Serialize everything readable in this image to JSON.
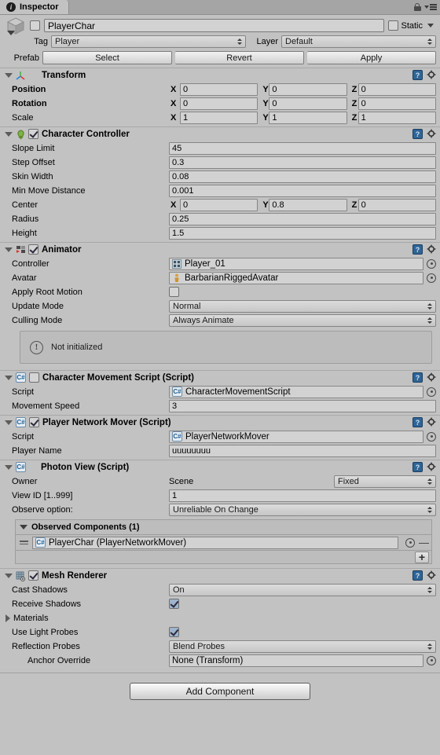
{
  "window": {
    "tab_label": "Inspector",
    "tab_icon": "info-icon",
    "lock_icon": "lock-icon",
    "menu_icon": "hamburger-menu-icon"
  },
  "gameobject": {
    "enabled": false,
    "name": "PlayerChar",
    "static_label": "Static",
    "static_checked": false,
    "tag_label": "Tag",
    "tag_value": "Player",
    "layer_label": "Layer",
    "layer_value": "Default",
    "prefab_label": "Prefab",
    "prefab_buttons": [
      "Select",
      "Revert",
      "Apply"
    ]
  },
  "components": [
    {
      "id": "transform",
      "title": "Transform",
      "icon": "transform-axis-icon",
      "has_checkbox": false,
      "rows": [
        {
          "type": "vector3",
          "label": "Position",
          "bold": true,
          "x": "0",
          "y": "0",
          "z": "0"
        },
        {
          "type": "vector3",
          "label": "Rotation",
          "bold": true,
          "x": "0",
          "y": "0",
          "z": "0"
        },
        {
          "type": "vector3",
          "label": "Scale",
          "bold": false,
          "x": "1",
          "y": "1",
          "z": "1"
        }
      ]
    },
    {
      "id": "character-controller",
      "title": "Character Controller",
      "icon": "character-controller-icon",
      "has_checkbox": true,
      "checked": true,
      "rows": [
        {
          "type": "text",
          "label": "Slope Limit",
          "value": "45"
        },
        {
          "type": "text",
          "label": "Step Offset",
          "value": "0.3"
        },
        {
          "type": "text",
          "label": "Skin Width",
          "value": "0.08"
        },
        {
          "type": "text",
          "label": "Min Move Distance",
          "value": "0.001"
        },
        {
          "type": "vector3",
          "label": "Center",
          "bold": false,
          "x": "0",
          "y": "0.8",
          "z": "0"
        },
        {
          "type": "text",
          "label": "Radius",
          "value": "0.25"
        },
        {
          "type": "text",
          "label": "Height",
          "value": "1.5"
        }
      ]
    },
    {
      "id": "animator",
      "title": "Animator",
      "icon": "animator-icon",
      "has_checkbox": true,
      "checked": true,
      "rows": [
        {
          "type": "object",
          "label": "Controller",
          "value": "Player_01",
          "icon": "animator-controller-icon"
        },
        {
          "type": "object",
          "label": "Avatar",
          "value": "BarbarianRiggedAvatar",
          "icon": "avatar-icon"
        },
        {
          "type": "checkbox",
          "label": "Apply Root Motion",
          "checked": false
        },
        {
          "type": "dropdown",
          "label": "Update Mode",
          "value": "Normal"
        },
        {
          "type": "dropdown",
          "label": "Culling Mode",
          "value": "Always Animate"
        },
        {
          "type": "helpbox",
          "message": "Not initialized",
          "icon": "warning-icon"
        }
      ]
    },
    {
      "id": "character-movement-script",
      "title": "Character Movement Script (Script)",
      "icon": "cs-script-icon",
      "has_checkbox": true,
      "checked": false,
      "rows": [
        {
          "type": "object",
          "label": "Script",
          "value": "CharacterMovementScript",
          "icon": "cs-script-icon"
        },
        {
          "type": "text",
          "label": "Movement Speed",
          "value": "3"
        }
      ]
    },
    {
      "id": "player-network-mover",
      "title": "Player Network Mover (Script)",
      "icon": "cs-script-icon",
      "has_checkbox": true,
      "checked": true,
      "rows": [
        {
          "type": "object",
          "label": "Script",
          "value": "PlayerNetworkMover",
          "icon": "cs-script-icon"
        },
        {
          "type": "text",
          "label": "Player Name",
          "value": "uuuuuuuu"
        }
      ]
    },
    {
      "id": "photon-view",
      "title": "Photon View (Script)",
      "icon": "cs-script-icon",
      "has_checkbox": false,
      "rows": [
        {
          "type": "owner",
          "label": "Owner",
          "scene_label": "Scene",
          "dropdown_value": "Fixed"
        },
        {
          "type": "text",
          "label": "View ID [1..999]",
          "value": "1"
        },
        {
          "type": "dropdown",
          "label": "Observe option:",
          "value": "Unreliable On Change"
        }
      ],
      "observed": {
        "header": "Observed Components (1)",
        "items": [
          {
            "value": "PlayerChar (PlayerNetworkMover)",
            "icon": "cs-script-icon"
          }
        ],
        "add_label": "+"
      }
    },
    {
      "id": "mesh-renderer",
      "title": "Mesh Renderer",
      "icon": "mesh-renderer-icon",
      "has_checkbox": true,
      "checked": true,
      "rows": [
        {
          "type": "dropdown",
          "label": "Cast Shadows",
          "value": "On"
        },
        {
          "type": "checkbox",
          "label": "Receive Shadows",
          "checked": true
        },
        {
          "type": "foldout",
          "label": "Materials"
        },
        {
          "type": "checkbox",
          "label": "Use Light Probes",
          "checked": true
        },
        {
          "type": "dropdown",
          "label": "Reflection Probes",
          "value": "Blend Probes"
        },
        {
          "type": "object",
          "label": "Anchor Override",
          "value": "None (Transform)",
          "indent": true
        }
      ]
    }
  ],
  "footer": {
    "add_component_label": "Add Component"
  },
  "colors": {
    "background": "#c2c2c2",
    "field": "#d2d2d2",
    "help_blue": "#2f6496",
    "checkbox_blue": "#9fb3cc"
  }
}
